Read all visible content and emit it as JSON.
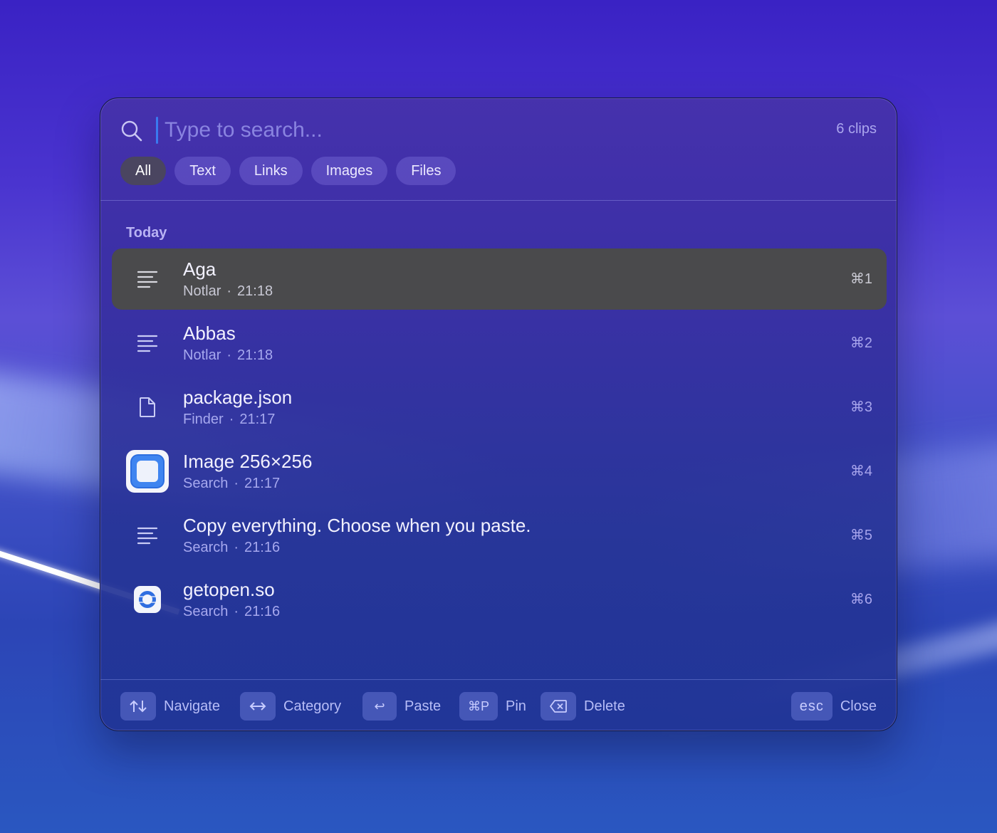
{
  "search": {
    "placeholder": "Type to search...",
    "value": "",
    "clip_count": "6 clips"
  },
  "filters": [
    {
      "label": "All",
      "active": true
    },
    {
      "label": "Text",
      "active": false
    },
    {
      "label": "Links",
      "active": false
    },
    {
      "label": "Images",
      "active": false
    },
    {
      "label": "Files",
      "active": false
    }
  ],
  "section": {
    "label": "Today"
  },
  "clips": [
    {
      "title": "Aga",
      "source": "Notlar",
      "time": "21:18",
      "shortcut": "⌘1",
      "icon": "text-lines-icon",
      "selected": true
    },
    {
      "title": "Abbas",
      "source": "Notlar",
      "time": "21:18",
      "shortcut": "⌘2",
      "icon": "text-lines-icon",
      "selected": false
    },
    {
      "title": "package.json",
      "source": "Finder",
      "time": "21:17",
      "shortcut": "⌘3",
      "icon": "file-icon",
      "selected": false
    },
    {
      "title": "Image 256×256",
      "source": "Search",
      "time": "21:17",
      "shortcut": "⌘4",
      "icon": "image-thumbnail-icon",
      "selected": false
    },
    {
      "title": "Copy everything. Choose when you paste.",
      "source": "Search",
      "time": "21:16",
      "shortcut": "⌘5",
      "icon": "text-lines-icon",
      "selected": false
    },
    {
      "title": "getopen.so",
      "source": "Search",
      "time": "21:16",
      "shortcut": "⌘6",
      "icon": "app-logo-icon",
      "selected": false
    }
  ],
  "footer": {
    "navigate": {
      "key_icon": "up-down-arrows-icon",
      "label": "Navigate"
    },
    "category": {
      "key_icon": "left-right-arrow-icon",
      "label": "Category"
    },
    "paste": {
      "key": "↩",
      "label": "Paste"
    },
    "pin": {
      "key": "⌘P",
      "label": "Pin"
    },
    "delete": {
      "key_icon": "delete-key-icon",
      "label": "Delete"
    },
    "close": {
      "key": "esc",
      "label": "Close"
    }
  },
  "colors": {
    "accent_caret": "#3a7af0",
    "selected_row": "#4a4a4c",
    "panel_top": "#463298",
    "panel_bottom": "#20349a"
  }
}
